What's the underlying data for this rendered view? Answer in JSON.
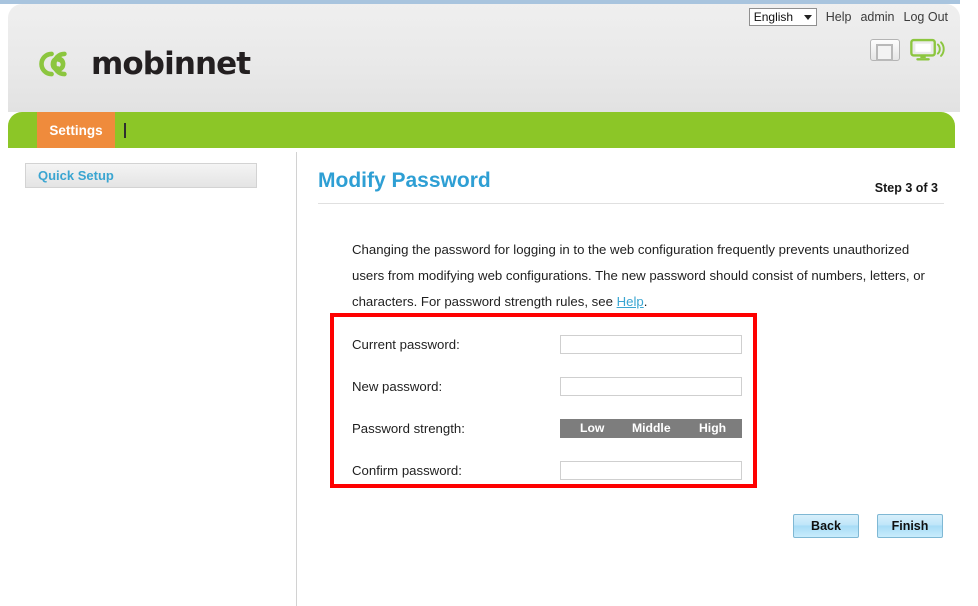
{
  "topbar": {
    "language": {
      "selected": "English",
      "options": [
        "English"
      ],
      "caret_icon": "chevron-down-icon"
    },
    "help_label": "Help",
    "user_label": "admin",
    "logout_label": "Log Out"
  },
  "brand": {
    "name": "mobinnet",
    "logo_icon": "mobinnet-spiral-logo",
    "logo_color": "#8cc63f",
    "text_color": "#231f20"
  },
  "status_icons": [
    {
      "name": "device-status-icon",
      "state": "inactive",
      "color": "#b4b4b4"
    },
    {
      "name": "network-monitor-icon",
      "state": "connected",
      "color": "#8cc63f"
    }
  ],
  "nav": {
    "tabs": [
      {
        "label": "Settings",
        "active": true
      }
    ],
    "bar_color": "#8cc627",
    "active_tab_color": "#ef8b3c"
  },
  "sidebar": {
    "items": [
      {
        "label": "Quick Setup",
        "selected": true
      }
    ]
  },
  "main": {
    "title": "Modify Password",
    "title_color": "#2e9fd4",
    "step_label": "Step 3 of 3",
    "intro_part1": "Changing the password for logging in to the web configuration frequently prevents unauthorized users from modifying web configurations. The new password should consist of numbers, letters, or characters. For password strength rules, see ",
    "intro_help_link": "Help",
    "intro_part2": ".",
    "form": {
      "current_password": {
        "label": "Current password:",
        "value": "",
        "placeholder": ""
      },
      "new_password": {
        "label": "New password:",
        "value": "",
        "placeholder": ""
      },
      "password_strength": {
        "label": "Password strength:",
        "levels": [
          "Low",
          "Middle",
          "High"
        ],
        "bar_color": "#7d7d7d",
        "active_level": ""
      },
      "confirm_password": {
        "label": "Confirm password:",
        "value": "",
        "placeholder": ""
      }
    },
    "buttons": {
      "back": "Back",
      "finish": "Finish"
    }
  },
  "annotation": {
    "highlight_box_color": "#fe0000"
  }
}
